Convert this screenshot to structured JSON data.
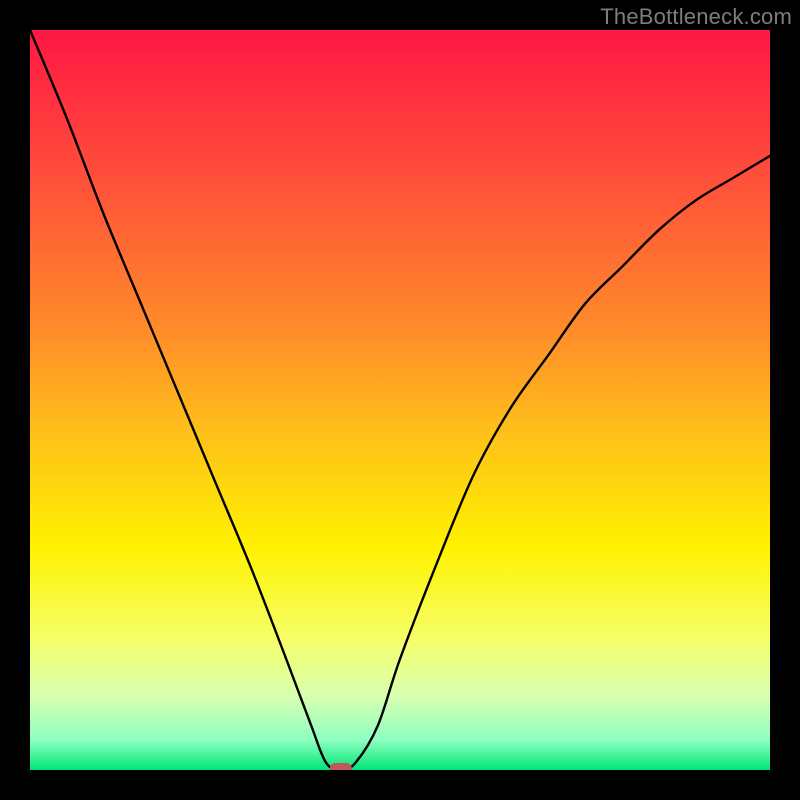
{
  "attribution": "TheBottleneck.com",
  "chart_data": {
    "type": "line",
    "title": "",
    "xlabel": "",
    "ylabel": "",
    "xlim": [
      0,
      100
    ],
    "ylim": [
      0,
      100
    ],
    "series": [
      {
        "name": "bottleneck-curve",
        "x": [
          0,
          5,
          10,
          15,
          20,
          25,
          30,
          35,
          38,
          40,
          42,
          44,
          47,
          50,
          55,
          60,
          65,
          70,
          75,
          80,
          85,
          90,
          95,
          100
        ],
        "values": [
          100,
          88,
          75,
          63,
          51,
          39,
          27,
          14,
          6,
          1,
          0,
          1,
          6,
          15,
          28,
          40,
          49,
          56,
          63,
          68,
          73,
          77,
          80,
          83
        ]
      }
    ],
    "marker": {
      "x": 42,
      "y": 0,
      "color": "#c05a5a",
      "shape": "rounded-rect"
    },
    "background_gradient": {
      "stops": [
        {
          "pos": 0.0,
          "color": "#ff1744"
        },
        {
          "pos": 0.2,
          "color": "#ff4f3a"
        },
        {
          "pos": 0.4,
          "color": "#ff8a2a"
        },
        {
          "pos": 0.55,
          "color": "#ffc219"
        },
        {
          "pos": 0.7,
          "color": "#fff200"
        },
        {
          "pos": 0.82,
          "color": "#f6ff66"
        },
        {
          "pos": 0.9,
          "color": "#d8ffb0"
        },
        {
          "pos": 0.96,
          "color": "#8cffc0"
        },
        {
          "pos": 1.0,
          "color": "#00e676"
        }
      ]
    }
  }
}
